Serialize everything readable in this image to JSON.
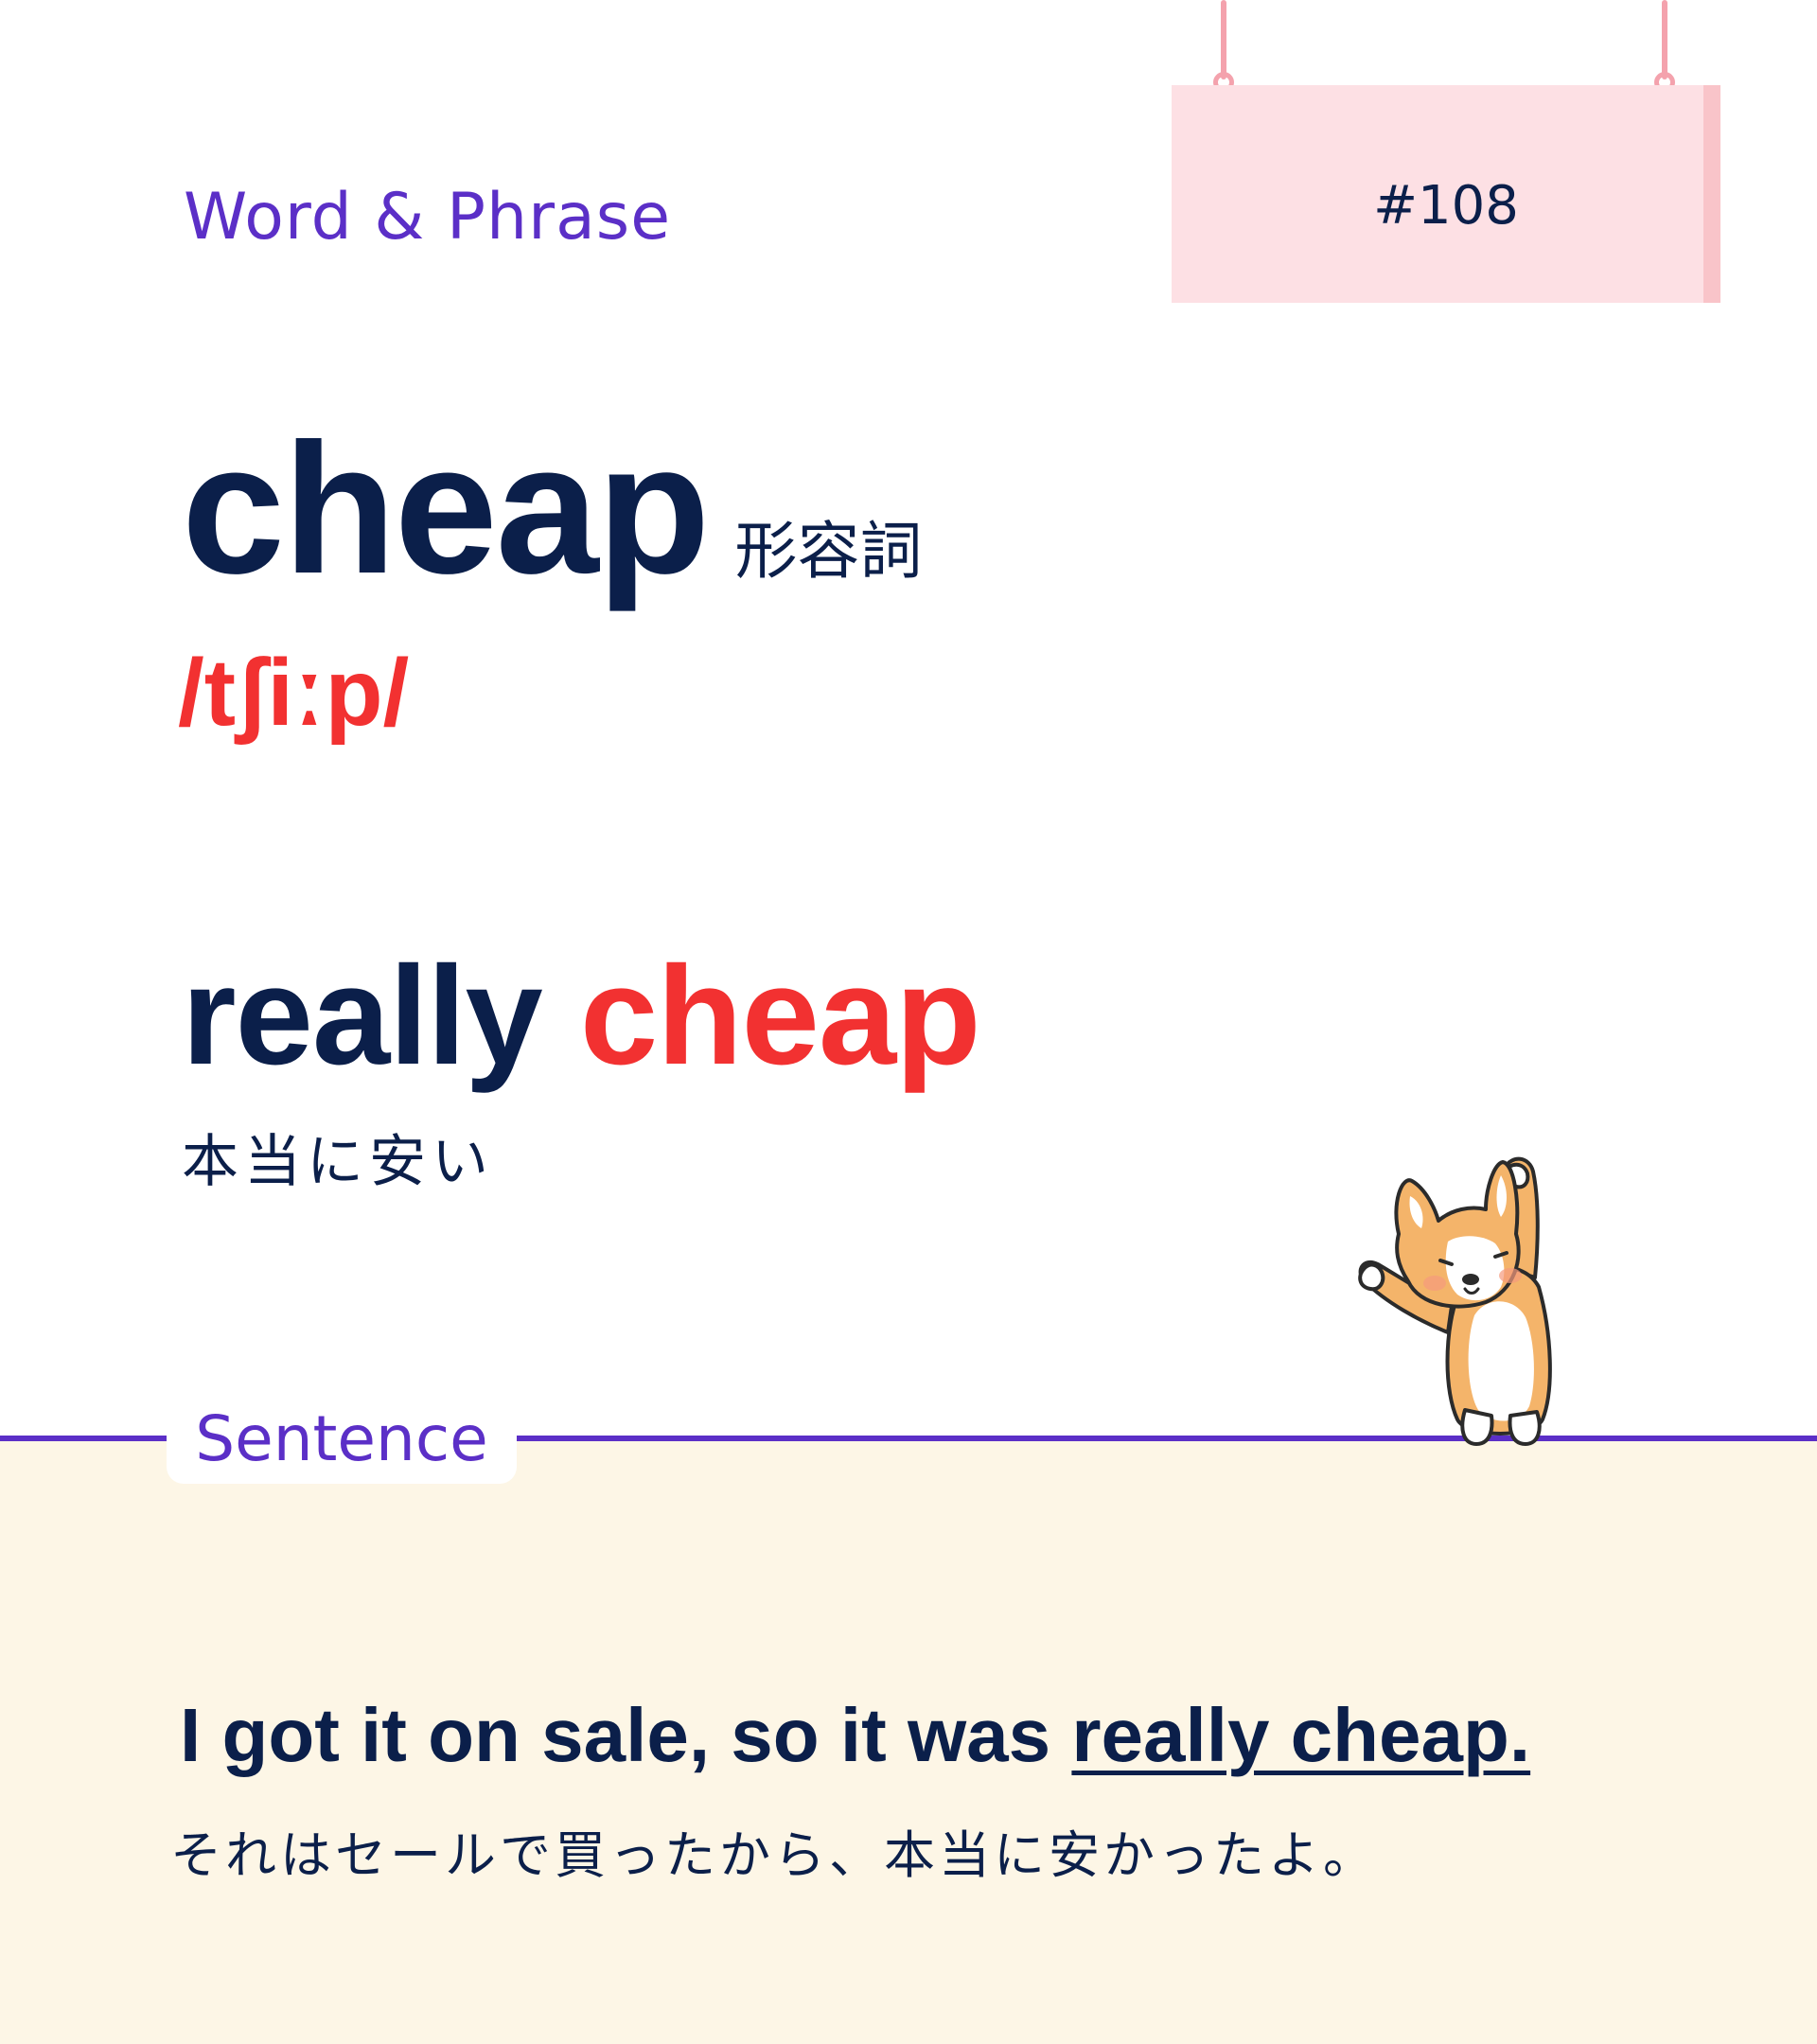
{
  "header": {
    "section_label": "Word & Phrase",
    "number": "#108"
  },
  "word": {
    "text": "cheap",
    "part_of_speech": "形容詞",
    "phonetic": "/tʃiːp/"
  },
  "phrase": {
    "part1": "really",
    "part2": "cheap",
    "translation": "本当に安い"
  },
  "sentence": {
    "label": "Sentence",
    "english_before": "I got it on sale, so it was ",
    "english_highlight": "really cheap.",
    "translation": "それはセールで買ったから、本当に安かったよ。"
  },
  "colors": {
    "navy": "#0b1f4a",
    "red": "#f23131",
    "purple": "#5b2fc7",
    "sign_pink": "#fde0e4",
    "cream": "#fdf6e6"
  },
  "icons": {
    "mascot": "corgi-waving-icon"
  }
}
